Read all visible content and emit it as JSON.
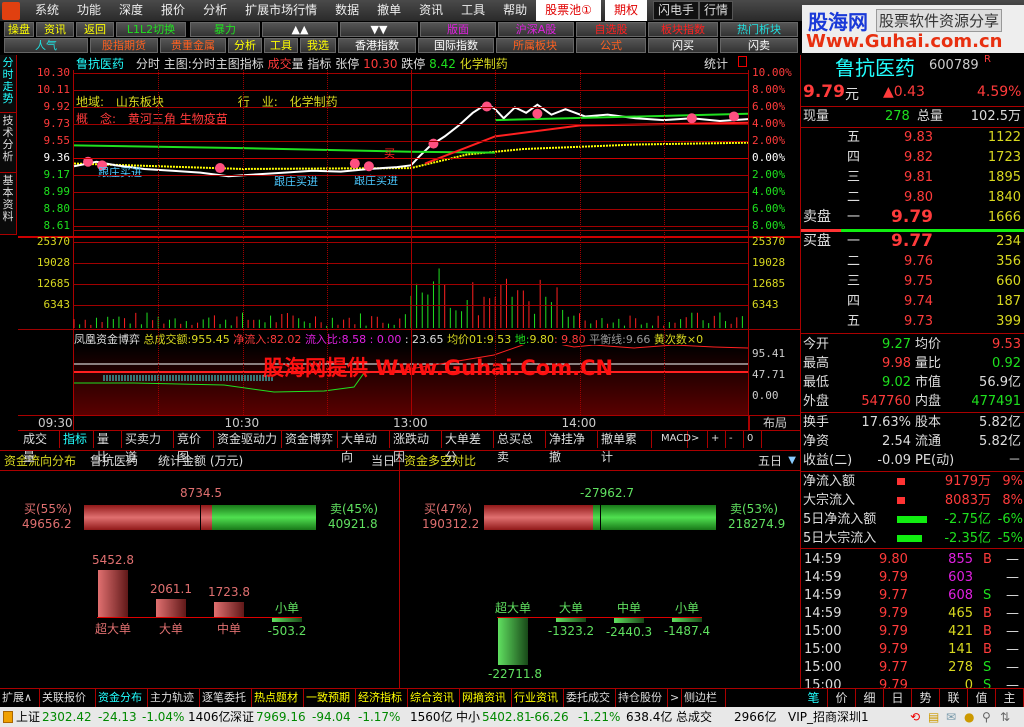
{
  "menu": {
    "items": [
      "系统",
      "功能",
      "深度",
      "报价",
      "分析",
      "扩展市场行情",
      "数据",
      "撤单",
      "资讯",
      "工具",
      "帮助"
    ],
    "stock_pool": "股票池①",
    "options": "期权",
    "flash": "闪电手",
    "quote": "行情"
  },
  "toolbar": {
    "row1": [
      {
        "label": "操盘",
        "color": "#ffff00"
      },
      {
        "label": "资讯",
        "color": "#ffff00"
      },
      {
        "label": "返回",
        "color": "#ffff00"
      },
      {
        "label": "L1L2切换",
        "color": "#20e020"
      },
      {
        "label": "暴力",
        "color": "#20e020"
      },
      {
        "label": "▲▲",
        "color": "#ffffff"
      },
      {
        "label": "▼▼",
        "color": "#ffffff"
      },
      {
        "label": "版面",
        "color": "#e020e0"
      },
      {
        "label": "沪深A股",
        "color": "#e020e0"
      },
      {
        "label": "自选股",
        "color": "#ff2020"
      },
      {
        "label": "板块指数",
        "color": "#ff2020"
      },
      {
        "label": "热门析块",
        "color": "#20e0e0"
      }
    ],
    "row2": [
      {
        "label": "人气",
        "color": "#20e0e0"
      },
      {
        "label": "股指期货",
        "color": "#ff6020"
      },
      {
        "label": "贵重金属",
        "color": "#ff6020"
      },
      {
        "label": "分析",
        "color": "#ffff00"
      },
      {
        "label": "工具",
        "color": "#ffff00"
      },
      {
        "label": "我选",
        "color": "#ffff00"
      },
      {
        "label": "香港指数",
        "color": "#ffffff"
      },
      {
        "label": "国际指数",
        "color": "#ffffff"
      },
      {
        "label": "所属板块",
        "color": "#ff6020"
      },
      {
        "label": "公式",
        "color": "#ff6020"
      },
      {
        "label": "闪买",
        "color": "#ffffff"
      },
      {
        "label": "闪卖",
        "color": "#ffffff"
      }
    ]
  },
  "watermark": {
    "brand": "股海网",
    "slogan": "股票软件资源分享",
    "url": "Www.Guhai.com.cn",
    "overlay": "股海网提供 Www.Guhai.Com.CN"
  },
  "side_tabs": [
    "分时走势",
    "技术分析",
    "基本资料"
  ],
  "chart": {
    "header": {
      "name": "鲁抗医药",
      "mode": "分时",
      "main": "主图:分时主图指标",
      "vol_a": "成交",
      "vol_b": "量",
      "indicator": "指标",
      "limit_up_label": "张停",
      "limit_up": "10.30",
      "limit_down_label": "跌停",
      "limit_down": "8.42",
      "industry": "化学制药",
      "stats": "统计"
    },
    "info": {
      "region_label": "地域:",
      "region": "山东板块",
      "industry_label": "行　业:",
      "industry": "化学制药",
      "concept_label": "概　念:",
      "concept": "黄河三角 生物疫苗"
    },
    "signals": [
      "跟庄买进",
      "跟庄买进",
      "跟庄买进",
      "买"
    ],
    "price_ticks": [
      "10.30",
      "10.11",
      "9.92",
      "9.73",
      "9.55",
      "9.36",
      "9.17",
      "8.99",
      "8.80",
      "8.61"
    ],
    "pct_ticks": [
      "10.00%",
      "8.00%",
      "6.00%",
      "4.00%",
      "2.00%",
      "0.00%",
      "2.00%",
      "4.00%",
      "6.00%",
      "8.00%"
    ],
    "vol_ticks": [
      "25370",
      "19028",
      "12685",
      "6343"
    ],
    "prev_close": 9.36,
    "price_series": [
      [
        0,
        9.27
      ],
      [
        8,
        9.32
      ],
      [
        15,
        9.28
      ],
      [
        25,
        9.24
      ],
      [
        35,
        9.22
      ],
      [
        45,
        9.2
      ],
      [
        55,
        9.16
      ],
      [
        65,
        9.18
      ],
      [
        75,
        9.2
      ],
      [
        85,
        9.22
      ],
      [
        95,
        9.21
      ],
      [
        105,
        9.24
      ],
      [
        115,
        9.26
      ],
      [
        120,
        9.28
      ],
      [
        123,
        9.38
      ],
      [
        127,
        9.5
      ],
      [
        132,
        9.6
      ],
      [
        137,
        9.72
      ],
      [
        142,
        9.86
      ],
      [
        147,
        9.96
      ],
      [
        150,
        9.9
      ],
      [
        153,
        9.8
      ],
      [
        157,
        9.92
      ],
      [
        161,
        9.86
      ],
      [
        165,
        9.95
      ],
      [
        170,
        9.84
      ],
      [
        175,
        9.9
      ],
      [
        182,
        9.82
      ],
      [
        190,
        9.84
      ],
      [
        200,
        9.8
      ],
      [
        210,
        9.78
      ],
      [
        220,
        9.8
      ],
      [
        230,
        9.77
      ],
      [
        240,
        9.79
      ]
    ],
    "avg_series": [
      [
        0,
        9.3
      ],
      [
        60,
        9.24
      ],
      [
        120,
        9.25
      ],
      [
        140,
        9.4
      ],
      [
        160,
        9.46
      ],
      [
        200,
        9.51
      ],
      [
        240,
        9.53
      ]
    ],
    "time_ticks": [
      "09:30",
      "10:30",
      "13:00",
      "14:00"
    ],
    "layout_btn": "布局"
  },
  "indicator": {
    "name": "凤凰资金博弈",
    "total_label": "总成交额:",
    "total": "955.45",
    "inflow_label": "净流入:",
    "inflow": "82.02",
    "ratio_label": "流入比:",
    "ratio": "8.58",
    "v1": ": 0.00",
    "v2": ": 23.65",
    "avg_label": "均价01:",
    "avg": "9.53",
    "di_label": "地:",
    "di": "9.80",
    "di2": ": 9.80",
    "balance_label": "平衡线:",
    "balance": "9.66",
    "yellow_label": "黄次数×0",
    "ticks": [
      "95.41",
      "47.71",
      "0.00"
    ]
  },
  "chart_tabs": [
    "成交量",
    "指标",
    "量比",
    "买卖力道",
    "竞价图",
    "资金驱动力",
    "资金博弈",
    "大单动向",
    "涨跌动因",
    "大单差分",
    "总买总卖",
    "净挂净撤",
    "撤单累计",
    "MACD",
    ">",
    "+",
    "-",
    "0"
  ],
  "quote": {
    "name": "鲁抗医药",
    "code": "600789",
    "flag": "R",
    "price": "9.79",
    "unit": "元",
    "change": "▲0.43",
    "pct": "4.59%",
    "cur_vol_label": "现量",
    "cur_vol": "278",
    "total_vol_label": "总量",
    "total_vol": "102.5万",
    "asks": [
      {
        "n": "五",
        "p": "9.83",
        "v": "1122"
      },
      {
        "n": "四",
        "p": "9.82",
        "v": "1723"
      },
      {
        "n": "三",
        "p": "9.81",
        "v": "1895"
      },
      {
        "n": "二",
        "p": "9.80",
        "v": "1840"
      },
      {
        "n": "一",
        "p": "9.79",
        "v": "1666"
      }
    ],
    "ask_label": "卖盘",
    "bid_label": "买盘",
    "bids": [
      {
        "n": "一",
        "p": "9.77",
        "v": "234"
      },
      {
        "n": "二",
        "p": "9.76",
        "v": "356"
      },
      {
        "n": "三",
        "p": "9.75",
        "v": "660"
      },
      {
        "n": "四",
        "p": "9.74",
        "v": "187"
      },
      {
        "n": "五",
        "p": "9.73",
        "v": "399"
      }
    ],
    "stats": [
      [
        "今开",
        "9.27",
        "均价",
        "9.53"
      ],
      [
        "最高",
        "9.98",
        "量比",
        "0.92"
      ],
      [
        "最低",
        "9.02",
        "市值",
        "56.9亿"
      ],
      [
        "外盘",
        "547760",
        "内盘",
        "477491"
      ]
    ],
    "stats2": [
      [
        "换手",
        "17.63%",
        "股本",
        "5.82亿"
      ],
      [
        "净资",
        "2.54",
        "流通",
        "5.82亿"
      ],
      [
        "收益(二)",
        "-0.09",
        "PE(动)",
        "－"
      ]
    ],
    "flows": [
      {
        "label": "净流入额",
        "value": "9179万",
        "pct": "9%",
        "dir": "up",
        "bar": 0.09
      },
      {
        "label": "大宗流入",
        "value": "8083万",
        "pct": "8%",
        "dir": "up",
        "bar": 0.08
      },
      {
        "label": "5日净流入额",
        "value": "-2.75亿",
        "pct": "-6%",
        "dir": "down",
        "bar": 0.6
      },
      {
        "label": "5日大宗流入",
        "value": "-2.35亿",
        "pct": "-5%",
        "dir": "down",
        "bar": 0.5
      }
    ],
    "ticks": [
      [
        "14:59",
        "9.80",
        "855",
        "B",
        "—"
      ],
      [
        "14:59",
        "9.79",
        "603",
        "",
        "—"
      ],
      [
        "14:59",
        "9.77",
        "608",
        "S",
        "—"
      ],
      [
        "14:59",
        "9.79",
        "465",
        "B",
        "—"
      ],
      [
        "15:00",
        "9.79",
        "421",
        "B",
        "—"
      ],
      [
        "15:00",
        "9.79",
        "141",
        "B",
        "—"
      ],
      [
        "15:00",
        "9.77",
        "278",
        "S",
        "—"
      ],
      [
        "15:00",
        "9.79",
        "0",
        "S",
        "—"
      ]
    ]
  },
  "flow_dist": {
    "title": "资金流向分布",
    "stock": "鲁抗医药",
    "unit": "统计金额 (万元)",
    "period": "当日",
    "net": "8734.5",
    "buy_label": "买(55%)",
    "buy": "49656.2",
    "sell_label": "卖(45%)",
    "sell": "40921.8",
    "buy_frac": 0.55,
    "bars": [
      {
        "label": "超大单",
        "value": 5452.8
      },
      {
        "label": "大单",
        "value": 2061.1
      },
      {
        "label": "中单",
        "value": 1723.8
      },
      {
        "label": "小单",
        "value": -503.2
      }
    ]
  },
  "flow_ls": {
    "title": "资金多空对比",
    "period": "五日",
    "net": "-27962.7",
    "buy_label": "买(47%)",
    "buy": "190312.2",
    "sell_label": "卖(53%)",
    "sell": "218274.9",
    "buy_frac": 0.47,
    "bars": [
      {
        "label": "超大单",
        "value": -22711.8
      },
      {
        "label": "大单",
        "value": -1323.2
      },
      {
        "label": "中单",
        "value": -2440.3
      },
      {
        "label": "小单",
        "value": -1487.4
      }
    ]
  },
  "bottom_tabs": [
    "扩展∧",
    "关联报价",
    "资金分布",
    "主力轨迹",
    "逐笔委托",
    "热点题材",
    "一致预期",
    "经济指标",
    "综合资讯",
    "网摘资讯",
    "行业资讯",
    "委托成交",
    "持仓股份",
    ">",
    "侧边栏<"
  ],
  "right_tabs": [
    "笔",
    "价",
    "细",
    "日",
    "势",
    "联",
    "值",
    "主"
  ],
  "status": {
    "sh_label": "上证",
    "sh": "2302.42",
    "sh_chg": "-24.13",
    "sh_pct": "-1.04%",
    "sh_amt": "1406亿",
    "sz_label": "深证",
    "sz": "7969.16",
    "sz_chg": "-94.04",
    "sz_pct": "-1.17%",
    "sz_amt": "1560亿",
    "zx_label": "中小",
    "zx": "5402.81",
    "zx_chg": "-66.26",
    "zx_pct": "-1.21%",
    "zx_amt": "638.4亿",
    "total_label": "总成交",
    "total": "2966亿",
    "server": "VIP_招商深圳1"
  }
}
